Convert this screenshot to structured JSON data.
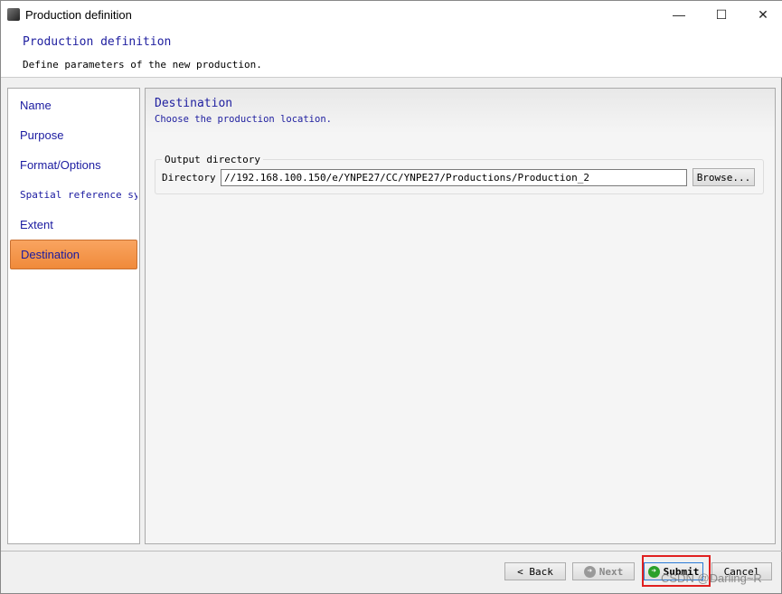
{
  "window": {
    "title": "Production definition",
    "minimize": "—",
    "maximize": "☐",
    "close": "✕"
  },
  "header": {
    "title": "Production definition",
    "subtitle": "Define parameters of the new production."
  },
  "sidebar": {
    "items": [
      {
        "label": "Name"
      },
      {
        "label": "Purpose"
      },
      {
        "label": "Format/Options"
      },
      {
        "label": "Spatial reference sy"
      },
      {
        "label": "Extent"
      },
      {
        "label": "Destination",
        "active": true
      }
    ]
  },
  "main": {
    "title": "Destination",
    "subtitle": "Choose the production location.",
    "group_label": "Output directory",
    "directory_label": "Directory",
    "directory_value": "//192.168.100.150/e/YNPE27/CC/YNPE27/Productions/Production_2",
    "browse_label": "Browse..."
  },
  "footer": {
    "back_label": "< Back",
    "next_label": "Next",
    "submit_label": "Submit",
    "cancel_label": "Cancel"
  },
  "watermark": "CSDN @Darling~R",
  "colors": {
    "accent_text": "#2020a0",
    "active_item": "#f08a3a",
    "highlight_box": "#e02020"
  }
}
